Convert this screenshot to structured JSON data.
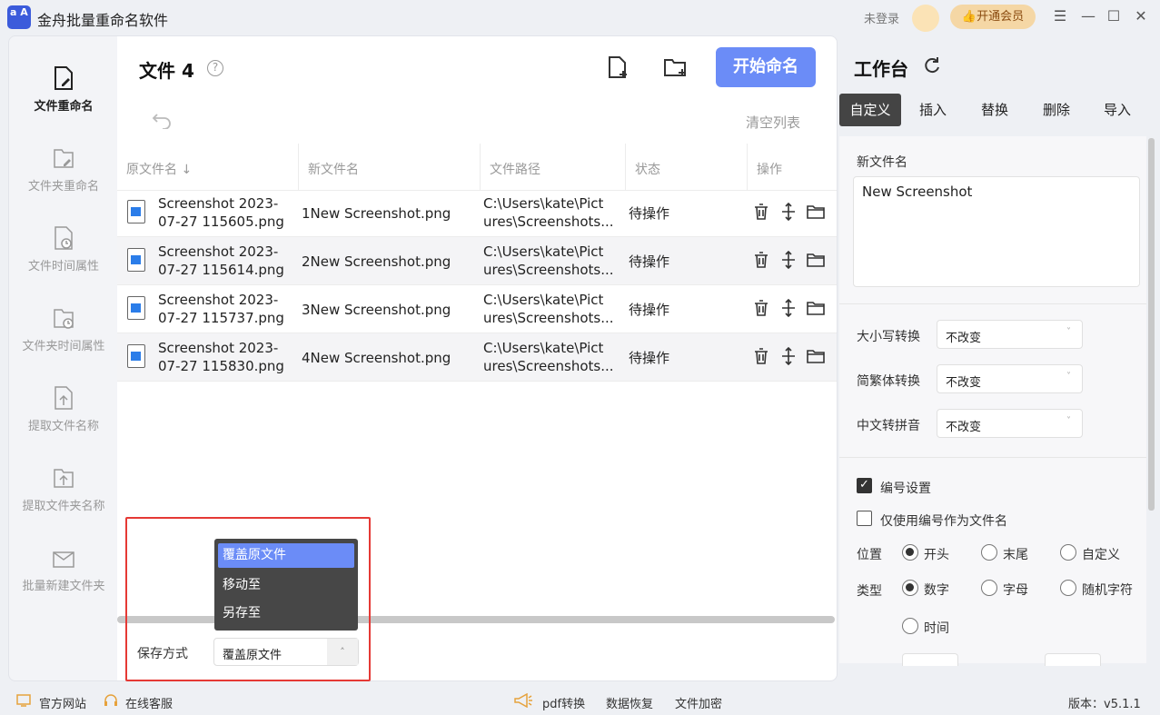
{
  "app": {
    "logo_text": "a A",
    "title": "金舟批量重命名软件",
    "login": "未登录",
    "vip": "开通会员"
  },
  "window": {
    "menu": "☰",
    "minimize": "—",
    "maximize": "☐",
    "close": "✕"
  },
  "nav": [
    {
      "label": "文件重命名",
      "active": true
    },
    {
      "label": "文件夹重命名"
    },
    {
      "label": "文件时间属性"
    },
    {
      "label": "文件夹时间属性"
    },
    {
      "label": "提取文件名称"
    },
    {
      "label": "提取文件夹名称"
    },
    {
      "label": "批量新建文件夹"
    }
  ],
  "main": {
    "title": "文件 4",
    "help": "?",
    "start_button": "开始命名",
    "clear_list": "清空列表",
    "columns": [
      "原文件名 ↓",
      "新文件名",
      "文件路径",
      "状态",
      "操作"
    ],
    "rows": [
      {
        "orig": "Screenshot 2023-07-27 115605.png",
        "orig1": "Screenshot 2023-",
        "orig2": "07-27 115605.png",
        "new": "1New Screenshot.png",
        "path1": "C:\\Users\\kate\\Pict",
        "path2": "ures\\Screenshots...",
        "status": "待操作"
      },
      {
        "orig": "Screenshot 2023-07-27 115614.png",
        "orig1": "Screenshot 2023-",
        "orig2": "07-27 115614.png",
        "new": "2New Screenshot.png",
        "path1": "C:\\Users\\kate\\Pict",
        "path2": "ures\\Screenshots...",
        "status": "待操作"
      },
      {
        "orig": "Screenshot 2023-07-27 115737.png",
        "orig1": "Screenshot 2023-",
        "orig2": "07-27 115737.png",
        "new": "3New Screenshot.png",
        "path1": "C:\\Users\\kate\\Pict",
        "path2": "ures\\Screenshots...",
        "status": "待操作"
      },
      {
        "orig": "Screenshot 2023-07-27 115830.png",
        "orig1": "Screenshot 2023-",
        "orig2": "07-27 115830.png",
        "new": "4New Screenshot.png",
        "path1": "C:\\Users\\kate\\Pict",
        "path2": "ures\\Screenshots...",
        "status": "待操作"
      }
    ],
    "save": {
      "label": "保存方式",
      "value": "覆盖原文件",
      "arrow": "˄",
      "options": [
        "覆盖原文件",
        "移动至",
        "另存至"
      ]
    }
  },
  "workbench": {
    "title": "工作台",
    "tabs": [
      "自定义",
      "插入",
      "替换",
      "删除",
      "导入"
    ],
    "new_name_label": "新文件名",
    "new_name_value": "New Screenshot",
    "case_label": "大小写转换",
    "case_value": "不改变",
    "trad_label": "简繁体转换",
    "trad_value": "不改变",
    "pinyin_label": "中文转拼音",
    "pinyin_value": "不改变",
    "chev": "˅",
    "numbering_label": "编号设置",
    "numbering_checked": true,
    "only_number_label": "仅使用编号作为文件名",
    "position_label": "位置",
    "position_options": [
      "开头",
      "末尾",
      "自定义"
    ],
    "type_label": "类型",
    "type_options": [
      "数字",
      "字母",
      "随机字符",
      "时间"
    ]
  },
  "footer": {
    "website": "官方网站",
    "service": "在线客服",
    "pdf": "pdf转换",
    "recover": "数据恢复",
    "encrypt": "文件加密",
    "version": "版本：v5.1.1"
  }
}
